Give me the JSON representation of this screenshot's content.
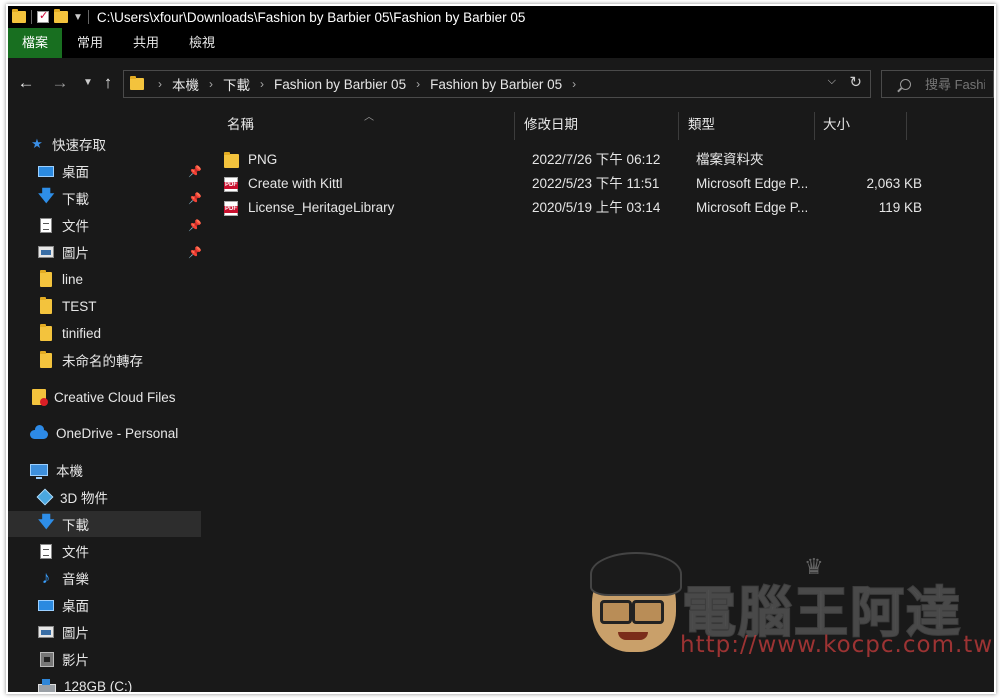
{
  "window": {
    "title_path": "C:\\Users\\xfour\\Downloads\\Fashion by Barbier 05\\Fashion by Barbier 05"
  },
  "ribbon": {
    "tabs": [
      "檔案",
      "常用",
      "共用",
      "檢視"
    ]
  },
  "address": {
    "crumbs": [
      "本機",
      "下載",
      "Fashion by Barbier 05",
      "Fashion by Barbier 05"
    ]
  },
  "search": {
    "placeholder": "搜尋 Fashi"
  },
  "nav": {
    "quick_access": "快速存取",
    "quick_items": [
      {
        "label": "桌面",
        "icon": "desktop-icon",
        "pinned": true
      },
      {
        "label": "下載",
        "icon": "download-arrow-icon",
        "pinned": true
      },
      {
        "label": "文件",
        "icon": "document-icon",
        "pinned": true
      },
      {
        "label": "圖片",
        "icon": "pictures-icon",
        "pinned": true
      },
      {
        "label": "line",
        "icon": "folder-icon",
        "pinned": false
      },
      {
        "label": "TEST",
        "icon": "folder-icon",
        "pinned": false
      },
      {
        "label": "tinified",
        "icon": "folder-icon",
        "pinned": false
      },
      {
        "label": "未命名的轉存",
        "icon": "folder-icon",
        "pinned": false
      }
    ],
    "creative_cloud": "Creative Cloud Files",
    "onedrive": "OneDrive - Personal",
    "this_pc": "本機",
    "pc_items": [
      {
        "label": "3D 物件",
        "icon": "3d-objects-icon"
      },
      {
        "label": "下載",
        "icon": "download-arrow-icon",
        "selected": true
      },
      {
        "label": "文件",
        "icon": "document-icon"
      },
      {
        "label": "音樂",
        "icon": "music-icon"
      },
      {
        "label": "桌面",
        "icon": "desktop-icon"
      },
      {
        "label": "圖片",
        "icon": "pictures-icon"
      },
      {
        "label": "影片",
        "icon": "video-icon"
      },
      {
        "label": "128GB (C:)",
        "icon": "drive-icon"
      }
    ]
  },
  "columns": {
    "name": "名稱",
    "modified": "修改日期",
    "type": "類型",
    "size": "大小"
  },
  "files": [
    {
      "name": "PNG",
      "modified": "2022/7/26 下午 06:12",
      "type": "檔案資料夾",
      "size": "",
      "icon": "folder-icon"
    },
    {
      "name": "Create with Kittl",
      "modified": "2022/5/23 下午 11:51",
      "type": "Microsoft Edge P...",
      "size": "2,063 KB",
      "icon": "pdf-icon"
    },
    {
      "name": "License_HeritageLibrary",
      "modified": "2020/5/19 上午 03:14",
      "type": "Microsoft Edge P...",
      "size": "119 KB",
      "icon": "pdf-icon"
    }
  ],
  "watermark": {
    "title": "電腦王阿達",
    "url": "http://www.kocpc.com.tw"
  }
}
